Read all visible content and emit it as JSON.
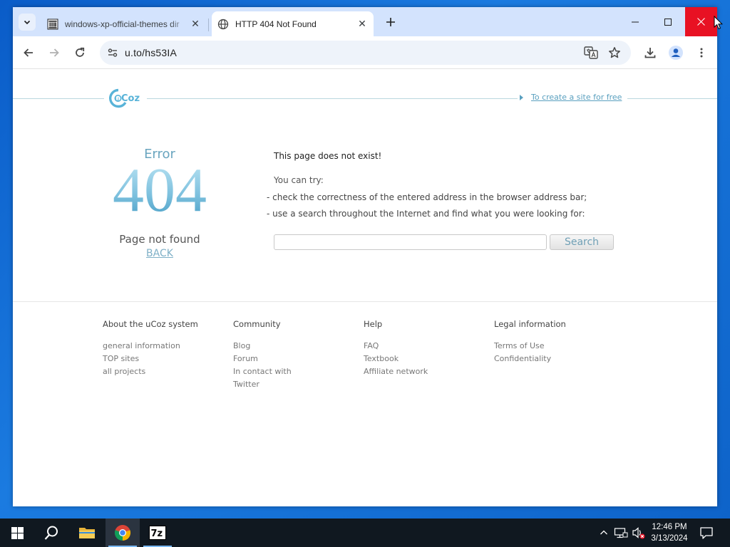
{
  "browser": {
    "tabs": [
      {
        "title": "windows-xp-official-themes dir",
        "active": false
      },
      {
        "title": "HTTP 404 Not Found",
        "active": true
      }
    ],
    "url": "u.to/hs53IA"
  },
  "page": {
    "create_site_link": "To create a site for free",
    "logo_text": "uCoz",
    "error": {
      "word": "Error",
      "code": "404",
      "message": "Page not found",
      "back": "BACK"
    },
    "message": {
      "title": "This page does not exist!",
      "try": "You can try:",
      "tips": [
        "- check the correctness of the entered address in the browser address bar;",
        "- use a search throughout the Internet and find what you were looking for:"
      ],
      "search_button": "Search",
      "search_value": ""
    },
    "footer": [
      {
        "heading": "About the uCoz system",
        "links": [
          "general information",
          "TOP sites",
          "all projects"
        ]
      },
      {
        "heading": "Community",
        "links": [
          "Blog",
          "Forum",
          "In contact with Twitter"
        ]
      },
      {
        "heading": "Help",
        "links": [
          "FAQ",
          "Textbook",
          "Affiliate network"
        ]
      },
      {
        "heading": "Legal information",
        "links": [
          "Terms of Use",
          "Confidentiality"
        ]
      }
    ]
  },
  "taskbar": {
    "time": "12:46 PM",
    "date": "3/13/2024",
    "apps": [
      "start-icon",
      "search-icon",
      "file-explorer-icon",
      "chrome-icon",
      "7zip-icon"
    ]
  },
  "colors": {
    "accent_link": "#5aa0bf",
    "error_code": "#8ecae3",
    "close_button": "#e81123",
    "tabstrip": "#d3e3fd"
  }
}
